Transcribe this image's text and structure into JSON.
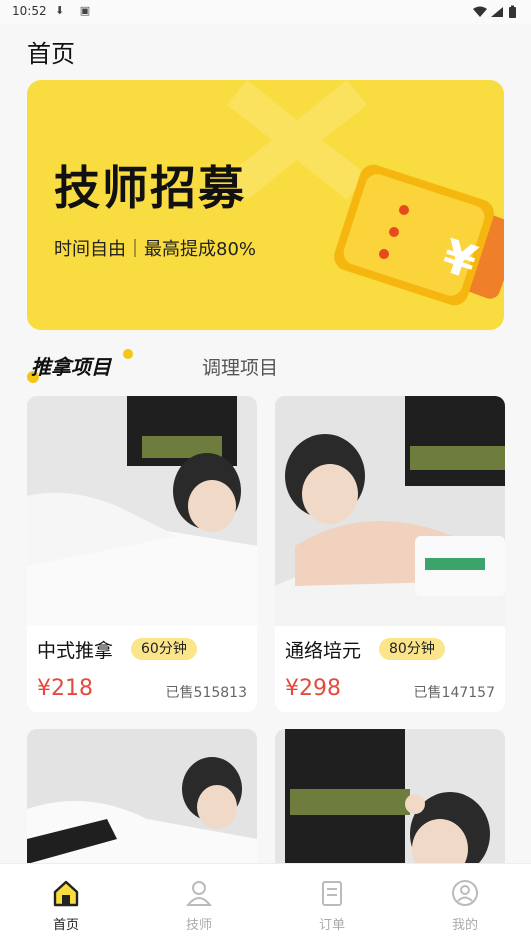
{
  "status_bar": {
    "time": "10:52"
  },
  "page": {
    "title": "首页"
  },
  "banner": {
    "title": "技师招募",
    "subtitle": "时间自由｜最高提成80%"
  },
  "tabs": [
    {
      "label": "推拿项目",
      "active": true
    },
    {
      "label": "调理项目",
      "active": false
    }
  ],
  "services": [
    {
      "name": "中式推拿",
      "duration": "60分钟",
      "price": "¥218",
      "sold": "已售515813"
    },
    {
      "name": "通络培元",
      "duration": "80分钟",
      "price": "¥298",
      "sold": "已售147157"
    }
  ],
  "bottom_nav": [
    {
      "label": "首页",
      "icon": "home-icon",
      "active": true
    },
    {
      "label": "技师",
      "icon": "technician-icon",
      "active": false
    },
    {
      "label": "订单",
      "icon": "order-icon",
      "active": false
    },
    {
      "label": "我的",
      "icon": "profile-icon",
      "active": false
    }
  ],
  "colors": {
    "accent": "#f9dc3f",
    "price": "#e64a3d",
    "badge": "#fbe58a"
  }
}
